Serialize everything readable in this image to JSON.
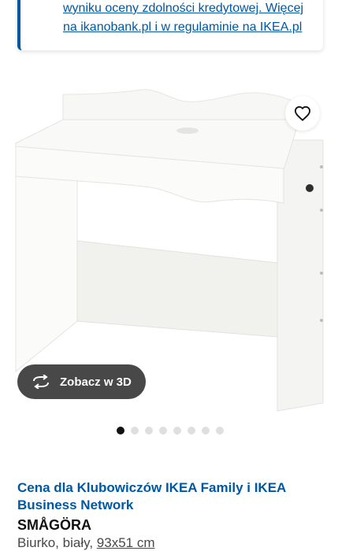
{
  "info_card": {
    "line1": "wyniku oceny zdolności kredytowej. Więcej",
    "line2": "na ikanobank.pl i w regulaminie na IKEA.pl"
  },
  "image": {
    "favorite_icon": "heart-icon",
    "view3d_icon": "rotate-icon",
    "view3d_label": "Zobacz w 3D"
  },
  "carousel": {
    "count": 8,
    "active_index": 0
  },
  "product": {
    "price_label": "Cena dla Klubowiczów IKEA Family i IKEA Business Network",
    "name": "SMÅGÖRA",
    "description": "Biurko, biały, ",
    "size": "93x51 cm"
  },
  "colors": {
    "accent": "#0058a3",
    "button_dark": "#484848"
  }
}
